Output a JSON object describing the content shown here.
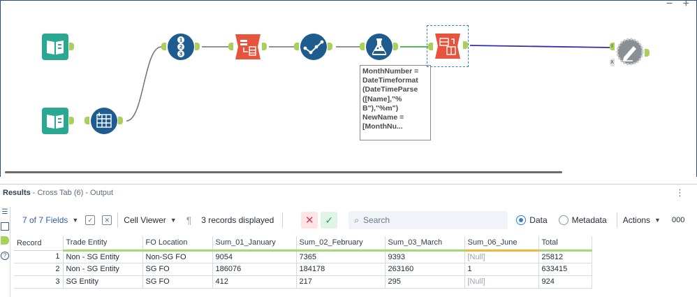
{
  "canvas": {
    "zoom_out": "−",
    "zoom_in": "+",
    "formula_tooltip": "MonthNumber = DateTimeformat (DateTimeParse ([Name],\"% B\"),\"%m\") NewName = [MonthNu...",
    "tools": [
      {
        "name": "input-data-tool-1",
        "color": "#2aa891"
      },
      {
        "name": "input-data-tool-2",
        "color": "#2aa891"
      },
      {
        "name": "dynamic-input-tool",
        "color": "#1e5b8f"
      },
      {
        "name": "record-id-tool",
        "color": "#1e5b8f"
      },
      {
        "name": "transpose-tool",
        "color": "#e8533c"
      },
      {
        "name": "select-tool",
        "color": "#1e5b8f"
      },
      {
        "name": "formula-tool",
        "color": "#1e5b8f"
      },
      {
        "name": "cross-tab-tool",
        "color": "#e8533c"
      },
      {
        "name": "browse-tool",
        "color": "#8a8f96"
      }
    ],
    "browse_anchor_labels": [
      "I",
      "X"
    ]
  },
  "results": {
    "title": "Results",
    "subtitle": "- Cross Tab (6) - Output",
    "toolbar": {
      "fields_label": "7 of 7 Fields",
      "cell_viewer_label": "Cell Viewer",
      "records_label": "3 records displayed",
      "search_placeholder": "Search",
      "data_label": "Data",
      "metadata_label": "Metadata",
      "actions_label": "Actions",
      "more_label": "000"
    },
    "columns": [
      {
        "label": "Record",
        "type": "num"
      },
      {
        "label": "Trade Entity",
        "type": "text"
      },
      {
        "label": "FO Location",
        "type": "text"
      },
      {
        "label": "Sum_01_January",
        "type": "text"
      },
      {
        "label": "Sum_02_February",
        "type": "text"
      },
      {
        "label": "Sum_03_March",
        "type": "text"
      },
      {
        "label": "Sum_06_June",
        "type": "text",
        "warn": true
      },
      {
        "label": "Total",
        "type": "text"
      }
    ],
    "rows": [
      [
        "1",
        "Non - SG Entity",
        "Non-SG FO",
        "9054",
        "7365",
        "9393",
        "[Null]",
        "25812"
      ],
      [
        "2",
        "Non - SG Entity",
        "SG FO",
        "186076",
        "184178",
        "263160",
        "1",
        "633415"
      ],
      [
        "3",
        "SG Entity",
        "SG FO",
        "412",
        "217",
        "295",
        "[Null]",
        "924"
      ]
    ]
  },
  "colors": {
    "accent_blue": "#2f80c9",
    "anchor_green": "#a8d05a",
    "warn_orange": "#f5b53c",
    "connection_blue": "#2f2fb0"
  }
}
